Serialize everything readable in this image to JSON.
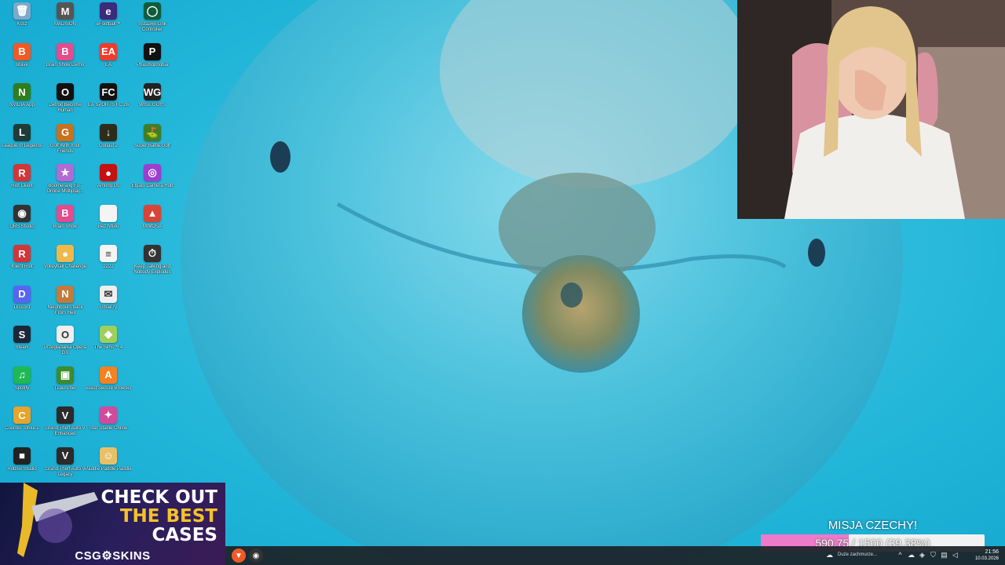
{
  "desktop": {
    "icons": [
      {
        "label": "Kosz",
        "icon": "recycle-bin-icon",
        "color": "#7fa8c9",
        "glyph": "🗑"
      },
      {
        "label": "Brave",
        "icon": "brave-icon",
        "color": "#f15a24",
        "glyph": "B"
      },
      {
        "label": "NVIDIA App",
        "icon": "nvidia-icon",
        "color": "#2f7d1f",
        "glyph": "N"
      },
      {
        "label": "League of Legends",
        "icon": "league-of-legends-icon",
        "color": "#1f3d36",
        "glyph": "L"
      },
      {
        "label": "Riot Client",
        "icon": "riot-client-icon",
        "color": "#d13639",
        "glyph": "R"
      },
      {
        "label": "OBS Studio",
        "icon": "obs-studio-icon",
        "color": "#333",
        "glyph": "◉"
      },
      {
        "label": "Klient Riot",
        "icon": "riot-client-icon",
        "color": "#d13639",
        "glyph": "R"
      },
      {
        "label": "Discord",
        "icon": "discord-icon",
        "color": "#5865f2",
        "glyph": "D"
      },
      {
        "label": "Steam",
        "icon": "steam-icon",
        "color": "#1b2838",
        "glyph": "S"
      },
      {
        "label": "Spotify",
        "icon": "spotify-icon",
        "color": "#1db954",
        "glyph": "♫"
      },
      {
        "label": "Counter-Strike 2",
        "icon": "counter-strike-icon",
        "color": "#e7a32b",
        "glyph": "C"
      },
      {
        "label": "Roblox Studio",
        "icon": "roblox-studio-icon",
        "color": "#222",
        "glyph": "■"
      },
      {
        "label": "MADISON",
        "icon": "madison-game-icon",
        "color": "#555",
        "glyph": "M"
      },
      {
        "label": "Brain Show Demo",
        "icon": "brain-show-icon",
        "color": "#e34c8d",
        "glyph": "B"
      },
      {
        "label": "Detroit Become Human",
        "icon": "detroit-icon",
        "color": "#111",
        "glyph": "O"
      },
      {
        "label": "Golf With Your Friends",
        "icon": "golf-game-icon",
        "color": "#c7721d",
        "glyph": "G"
      },
      {
        "label": "Boomerang Fu - Online Multiplay...",
        "icon": "boomerang-fu-icon",
        "color": "#b06bd6",
        "glyph": "★"
      },
      {
        "label": "Brain Show",
        "icon": "brain-show-icon",
        "color": "#e34c8d",
        "glyph": "B"
      },
      {
        "label": "Volleyball Challenge",
        "icon": "volleyball-icon",
        "color": "#f0b84b",
        "glyph": "●"
      },
      {
        "label": "Neighbours back From Hell",
        "icon": "neighbours-game-icon",
        "color": "#c47a3a",
        "glyph": "N"
      },
      {
        "label": "Przeglądarka Opera GX",
        "icon": "opera-gx-icon",
        "color": "#eee",
        "glyph": "O"
      },
      {
        "label": "TLauncher",
        "icon": "tlauncher-icon",
        "color": "#3c8b2c",
        "glyph": "▣"
      },
      {
        "label": "Grand Theft Auto V Enhanced",
        "icon": "gta-v-icon",
        "color": "#2b2b2b",
        "glyph": "V"
      },
      {
        "label": "Grand Theft Auto V Legacy",
        "icon": "gta-v-icon",
        "color": "#2b2b2b",
        "glyph": "V"
      },
      {
        "label": "eFootball™",
        "icon": "efootball-icon",
        "color": "#3a2b7d",
        "glyph": "e"
      },
      {
        "label": "EA",
        "icon": "ea-icon",
        "color": "#ef3b2c",
        "glyph": "EA"
      },
      {
        "label": "EA SPORTS FC 26",
        "icon": "ea-sports-fc-icon",
        "color": "#111",
        "glyph": "FC"
      },
      {
        "label": "Outlast 2",
        "icon": "outlast-icon",
        "color": "#2d2d1d",
        "glyph": "↓"
      },
      {
        "label": "Among Us",
        "icon": "among-us-icon",
        "color": "#c51111",
        "glyph": "●"
      },
      {
        "label": "Bez tytułu",
        "icon": "blank-document-icon",
        "color": "#f4f4f4",
        "glyph": " "
      },
      {
        "label": "2222",
        "icon": "text-file-icon",
        "color": "#f4f4f4",
        "glyph": "≡"
      },
      {
        "label": "Gmail.ry",
        "icon": "gmail-shortcut-icon",
        "color": "#eee",
        "glyph": "✉"
      },
      {
        "label": "The Sims™ 4",
        "icon": "the-sims-icon",
        "color": "#9ecf5a",
        "glyph": "◆"
      },
      {
        "label": "Avast Secure Browser",
        "icon": "avast-browser-icon",
        "color": "#f58220",
        "glyph": "A"
      },
      {
        "label": "Star Stable Online",
        "icon": "star-stable-icon",
        "color": "#d04b9d",
        "glyph": "✦"
      },
      {
        "label": "Paddle Paddle Paddle",
        "icon": "paddle-game-icon",
        "color": "#e9c06a",
        "glyph": "☺"
      },
      {
        "label": "Insta360 Link Controller",
        "icon": "insta360-icon",
        "color": "#0f5c3c",
        "glyph": "◯"
      },
      {
        "label": "Phasmophobia",
        "icon": "phasmophobia-icon",
        "color": "#111",
        "glyph": "P"
      },
      {
        "label": "WISE GUYS",
        "icon": "wise-guys-icon",
        "color": "#222",
        "glyph": "WG"
      },
      {
        "label": "Super Battle Golf",
        "icon": "super-battle-golf-icon",
        "color": "#3f7d2a",
        "glyph": "⛳"
      },
      {
        "label": "Elgato Camera Hub",
        "icon": "elgato-camera-hub-icon",
        "color": "#9b3fd1",
        "glyph": "◎"
      },
      {
        "label": "MIMOSA",
        "icon": "mimosa-icon",
        "color": "#d6453a",
        "glyph": "▲"
      },
      {
        "label": "Keep Talking and Nobody Explodes",
        "icon": "keep-talking-icon",
        "color": "#333",
        "glyph": "⏱"
      }
    ]
  },
  "ad": {
    "line1": "CHECK OUT",
    "line2": "THE BEST",
    "line3": "CASES",
    "brand": "CSG⚙SKINS"
  },
  "mission": {
    "title": "MISJA CZECHY!",
    "progress_text": "590.75 / 1500 (39.38%)",
    "progress_fraction": 0.3938
  },
  "taskbar": {
    "apps": [
      {
        "name": "brave-taskbar-icon",
        "color": "#f15a24",
        "glyph": "▼"
      },
      {
        "name": "obs-taskbar-icon",
        "color": "#333",
        "glyph": "◉"
      }
    ],
    "weather_text": "Duże zachmurze...",
    "time": "21:56",
    "date": "10.03.2026"
  }
}
